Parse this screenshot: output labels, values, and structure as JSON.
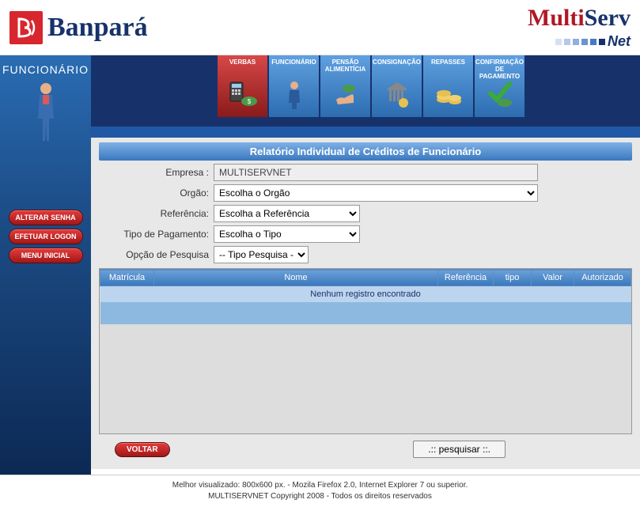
{
  "header": {
    "banpara": "Banpará",
    "multi_part1": "Multi",
    "multi_part2": "Serv",
    "net": "Net"
  },
  "sidebar": {
    "title": "FUNCIONÁRIO",
    "buttons": {
      "alterar_senha": "ALTERAR SENHA",
      "efetuar_logon": "EFETUAR LOGON",
      "menu_inicial": "MENU INICIAL"
    }
  },
  "topnav": {
    "verbas": "VERBAS",
    "funcionario": "FUNCIONÁRIO",
    "pensao": "PENSÃO ALIMENTÍCIA",
    "consignacao": "CONSIGNAÇÃO",
    "repasses": "REPASSES",
    "confirmacao": "CONFIRMAÇÃO DE PAGAMENTO"
  },
  "form": {
    "section_title": "Relatório Individual de Créditos de Funcionário",
    "labels": {
      "empresa": "Empresa :",
      "orgao": "Orgão:",
      "referencia": "Referência:",
      "tipo_pagamento": "Tipo de Pagamento:",
      "opcao_pesquisa": "Opção de Pesquisa"
    },
    "values": {
      "empresa": "MULTISERVNET",
      "orgao": "Escolha o Orgão",
      "referencia": "Escolha a Referência",
      "tipo_pagamento": "Escolha o Tipo",
      "opcao_pesquisa": "-- Tipo Pesquisa --"
    }
  },
  "table": {
    "headers": {
      "matricula": "Matrícula",
      "nome": "Nome",
      "referencia": "Referência",
      "tipo": "tipo",
      "valor": "Valor",
      "autorizado": "Autorizado"
    },
    "no_record": "Nenhum registro encontrado"
  },
  "buttons": {
    "voltar": "VOLTAR",
    "pesquisar": ".:: pesquisar ::."
  },
  "footer": {
    "line1": "Melhor visualizado: 800x600 px. - Mozila Firefox 2.0, Internet Explorer 7 ou superior.",
    "line2": "MULTISERVNET Copyright 2008 - Todos os direitos reservados"
  }
}
